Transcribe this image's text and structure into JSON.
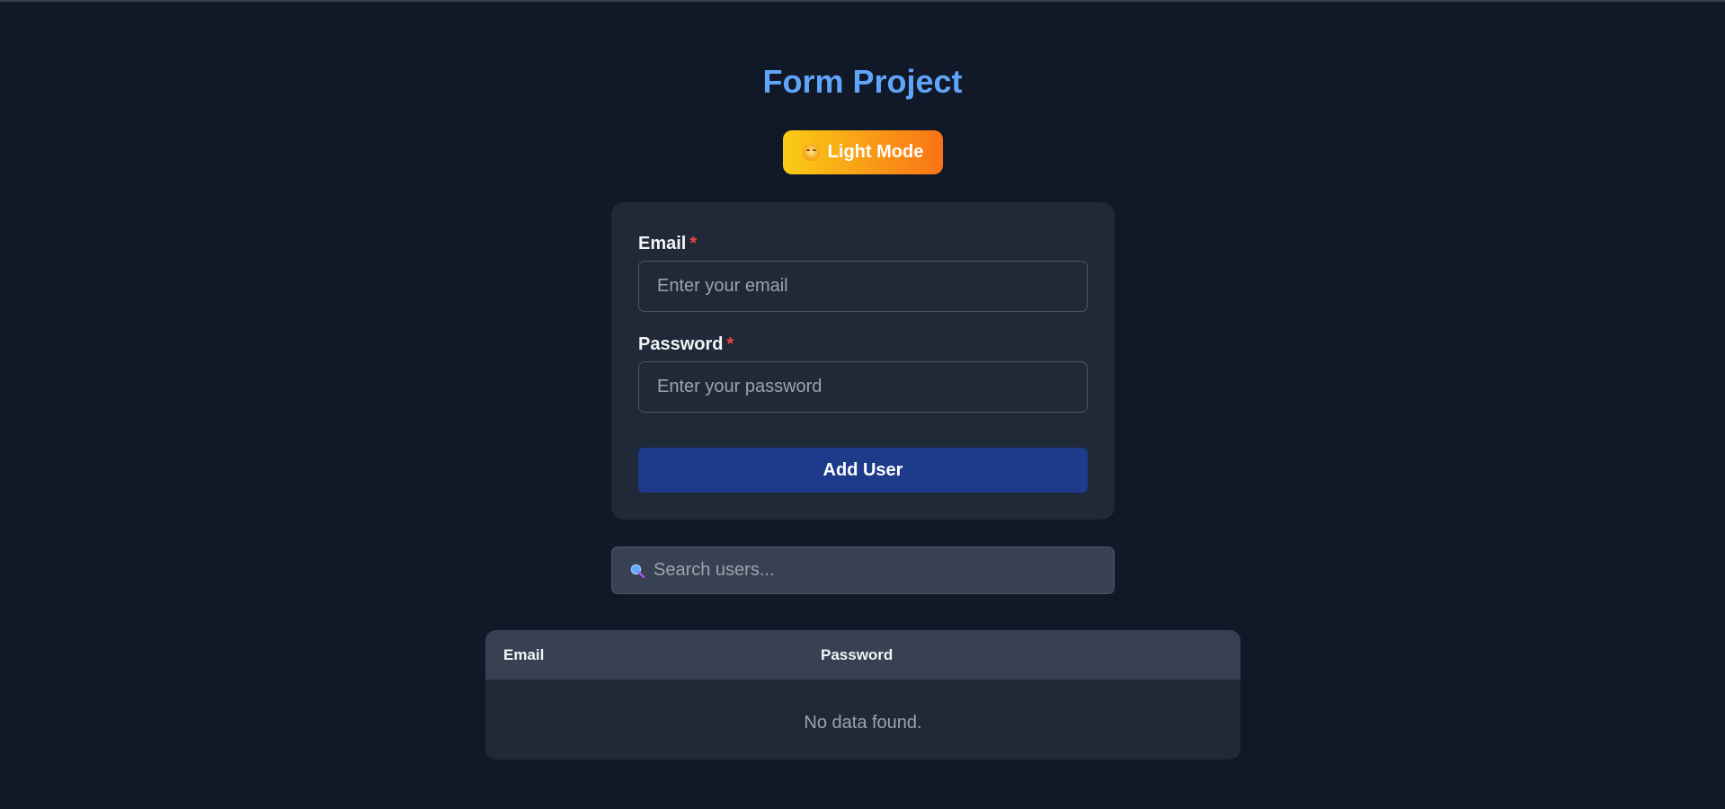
{
  "app": {
    "title": "Form Project",
    "theme_toggle_label": "Light Mode"
  },
  "form": {
    "email": {
      "label": "Email",
      "required_mark": "*",
      "placeholder": "Enter your email",
      "value": ""
    },
    "password": {
      "label": "Password",
      "required_mark": "*",
      "placeholder": "Enter your password",
      "value": ""
    },
    "submit_label": "Add User"
  },
  "search": {
    "placeholder": "Search users...",
    "value": ""
  },
  "table": {
    "columns": [
      "Email",
      "Password"
    ],
    "rows": [],
    "empty_message": "No data found."
  },
  "colors": {
    "background": "#111827",
    "card": "#1f2937",
    "title": "#60a5fa",
    "submit": "#1e3a8a",
    "required": "#ef4444",
    "toggle_gradient_start": "#facc15",
    "toggle_gradient_end": "#f97316"
  },
  "icons": {
    "theme": "sun-face-icon",
    "search": "magnifier-icon"
  }
}
